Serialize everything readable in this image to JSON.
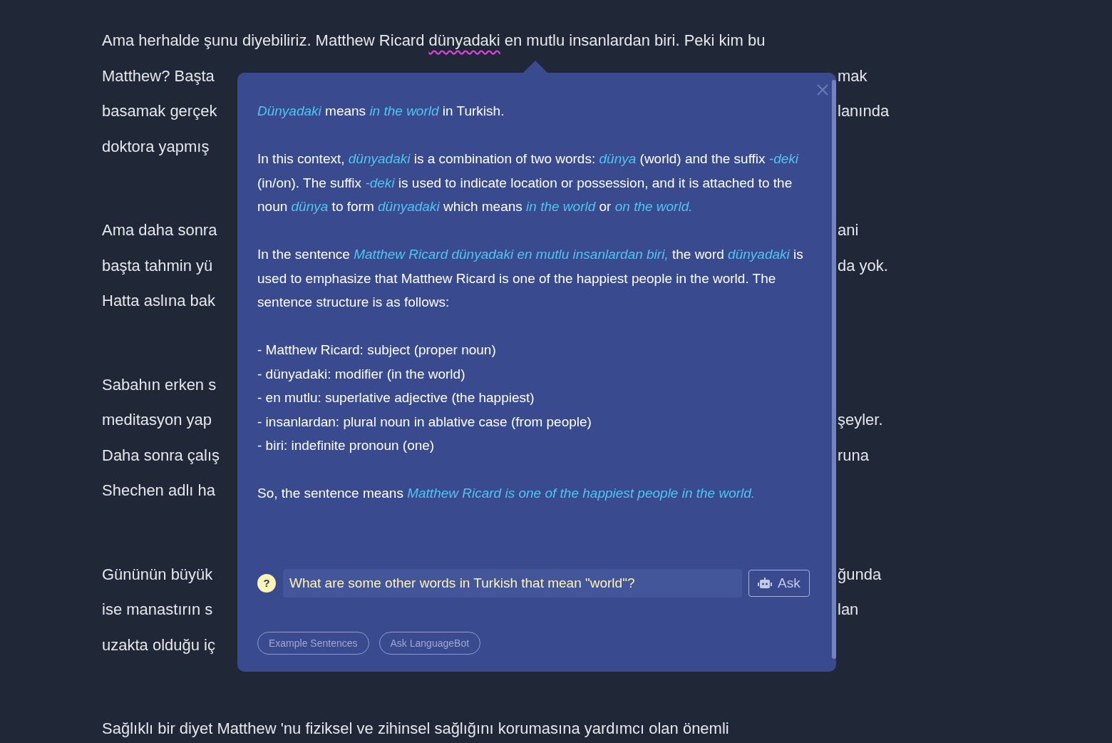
{
  "article": {
    "paragraphs": [
      {
        "lines": [
          {
            "kind": "highlighted",
            "before": "Ama herhalde şunu diyebiliriz. Matthew Ricard",
            "word": "dünyadaki",
            "after": "en mutlu insanlardan biri. Peki kim bu"
          },
          {
            "kind": "split",
            "left": "Matthew? Başta",
            "right": "mak"
          },
          {
            "kind": "split",
            "left": "basamak gerçek",
            "right": "lanında"
          },
          {
            "kind": "split",
            "left": "doktora yapmış"
          }
        ]
      },
      {
        "lines": [
          {
            "kind": "split",
            "left": "Ama daha sonra",
            "right": "ani"
          },
          {
            "kind": "split",
            "left": "başta tahmin yü",
            "right": "da yok."
          },
          {
            "kind": "split",
            "left": "Hatta aslına bak"
          }
        ]
      },
      {
        "lines": [
          {
            "kind": "split",
            "left": "Sabahın erken s"
          },
          {
            "kind": "split",
            "left": "meditasyon yap",
            "right": "şeyler."
          },
          {
            "kind": "split",
            "left": "Daha sonra çalış",
            "right": "runa"
          },
          {
            "kind": "split",
            "left": "Shechen adlı ha"
          }
        ]
      },
      {
        "lines": [
          {
            "kind": "split",
            "left": "Gününün büyük",
            "right": "ğunda"
          },
          {
            "kind": "split",
            "left": "ise manastırın s",
            "right": "lan"
          },
          {
            "kind": "split",
            "left": "uzakta olduğu iç"
          }
        ]
      },
      {
        "lines": [
          {
            "kind": "split",
            "left": "Sağlıklı bir diyet Matthew 'nu fiziksel ve zihinsel sağlığını korumasına yardımcı olan önemli"
          }
        ]
      }
    ]
  },
  "popup": {
    "paragraphs": [
      "*Dünyadaki* means *in the world* in Turkish.",
      "In this context, *dünyadaki* is a combination of two words: *dünya* (world) and the suffix *-deki* (in/on). The suffix *-deki* is used to indicate location or possession, and it is attached to the noun *dünya* to form *dünyadaki* which means *in the world* or *on the world.*",
      "In the sentence *Matthew Ricard dünyadaki en mutlu insanlardan biri,* the word *dünyadaki* is used to emphasize that Matthew Ricard is one of the happiest people in the world. The sentence structure is as follows:"
    ],
    "list": [
      "- Matthew Ricard: subject (proper noun)",
      "- dünyadaki: modifier (in the world)",
      "- en mutlu: superlative adjective (the happiest)",
      "- insanlardan: plural noun in ablative case (from people)",
      "- biri: indefinite pronoun (one)"
    ],
    "conclusion": "So, the sentence means *Matthew Ricard is one of the happiest people in the world.*",
    "help_icon": "?",
    "question": {
      "value": "What are some other words in Turkish that mean \"world\"?"
    },
    "ask_button": "Ask",
    "chips": [
      "Example Sentences",
      "Ask LanguageBot"
    ]
  }
}
